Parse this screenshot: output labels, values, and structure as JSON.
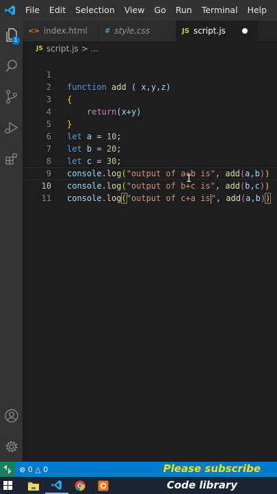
{
  "menu": [
    "File",
    "Edit",
    "Selection",
    "View",
    "Go",
    "Run",
    "Terminal",
    "Help"
  ],
  "activity": {
    "explorer_badge": "1"
  },
  "tabs": [
    {
      "label": "index.html",
      "icon": "<>"
    },
    {
      "label": "style.css",
      "icon": "#"
    },
    {
      "label": "script.js",
      "icon": "JS"
    }
  ],
  "breadcrumb": {
    "icon": "JS",
    "file": "script.js",
    "rest": "> ..."
  },
  "editor": {
    "line_numbers": [
      "1",
      "2",
      "3",
      "4",
      "5",
      "6",
      "7",
      "8",
      "9",
      "10",
      "11"
    ],
    "lines": {
      "l1": {
        "kw": "function",
        "fn": "add",
        "rest": " ( x,y,z)"
      },
      "l2": "{",
      "l3": {
        "ctrl": "return",
        "rest": "(x+y)"
      },
      "l4": "}",
      "l5": {
        "kw": "let",
        "var": "a",
        "num": "10"
      },
      "l6": {
        "kw": "let",
        "var": "b",
        "num": "20"
      },
      "l7": {
        "kw": "let",
        "var": "c",
        "num": "30"
      },
      "l8": {
        "obj": "console",
        "fn": "log",
        "str": "\"output of a+b is\"",
        "call": "add",
        "args": "a,b"
      },
      "l9": {
        "obj": "console",
        "fn": "log",
        "str": "\"output of b+c is\"",
        "call": "add",
        "args": "b,c"
      },
      "l10": {
        "obj": "console",
        "fn": "log",
        "str_a": "\"output of c+a is",
        "str_b": "\"",
        "call": "add",
        "args": "a,b"
      }
    }
  },
  "status": {
    "errors": "0",
    "warnings": "0"
  },
  "overlay": {
    "line1": "Please subscribe",
    "line2": "Code library"
  },
  "colors": {
    "accent": "#007acc",
    "background": "#1e1e1e",
    "caption_yellow": "#f5e400"
  }
}
